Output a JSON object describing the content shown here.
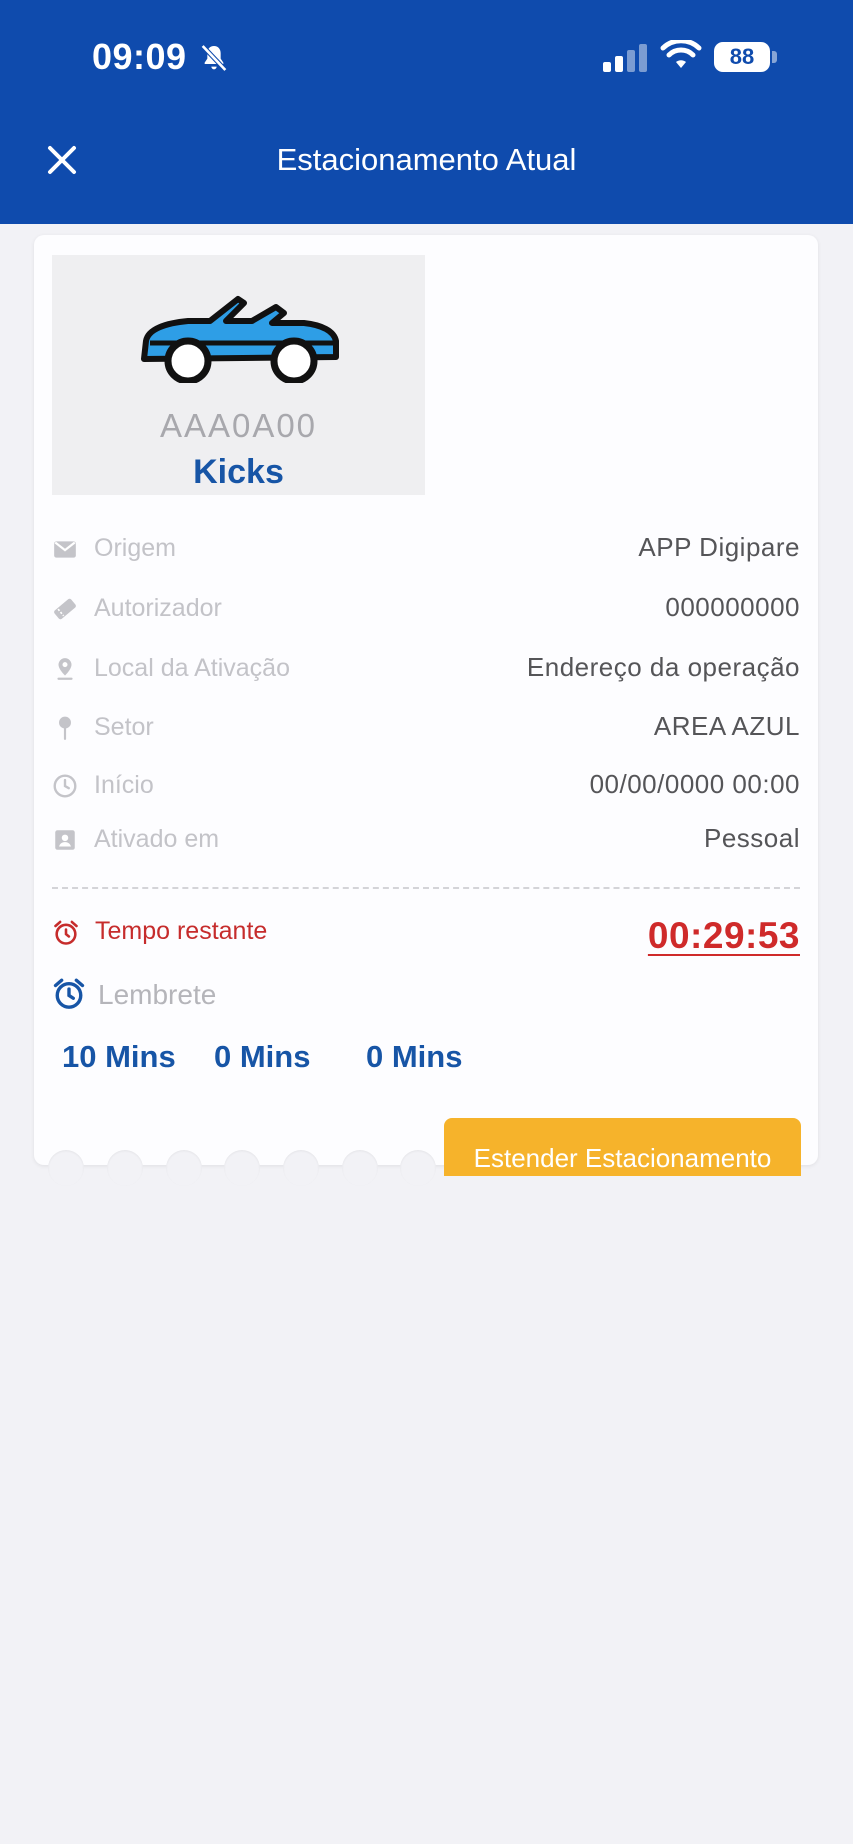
{
  "status_bar": {
    "time": "09:09",
    "battery": "88"
  },
  "header": {
    "title": "Estacionamento Atual",
    "background_color": "#0f4bad"
  },
  "vehicle": {
    "plate": "AAA0A00",
    "model": "Kicks",
    "icon": "convertible-car-icon",
    "car_color": "#2e9ee6"
  },
  "details": [
    {
      "icon": "envelope-icon",
      "label": "Origem",
      "value": "APP Digipare"
    },
    {
      "icon": "ticket-icon",
      "label": "Autorizador",
      "value": "000000000"
    },
    {
      "icon": "location-pin-icon",
      "label": "Local da Ativação",
      "value": "Endereço da operação"
    },
    {
      "icon": "pushpin-icon",
      "label": "Setor",
      "value": "AREA AZUL"
    },
    {
      "icon": "clock-icon",
      "label": "Início",
      "value": "00/00/0000 00:00"
    },
    {
      "icon": "contact-icon",
      "label": "Ativado em",
      "value": "Pessoal"
    }
  ],
  "remaining": {
    "label": "Tempo restante",
    "value": "00:29:53",
    "color": "#cf2a2a"
  },
  "reminder": {
    "label": "Lembrete",
    "options": [
      "10 Mins",
      "0 Mins",
      "0 Mins"
    ]
  },
  "extend_button": {
    "label": "Estender Estacionamento",
    "color": "#f6b32b"
  }
}
